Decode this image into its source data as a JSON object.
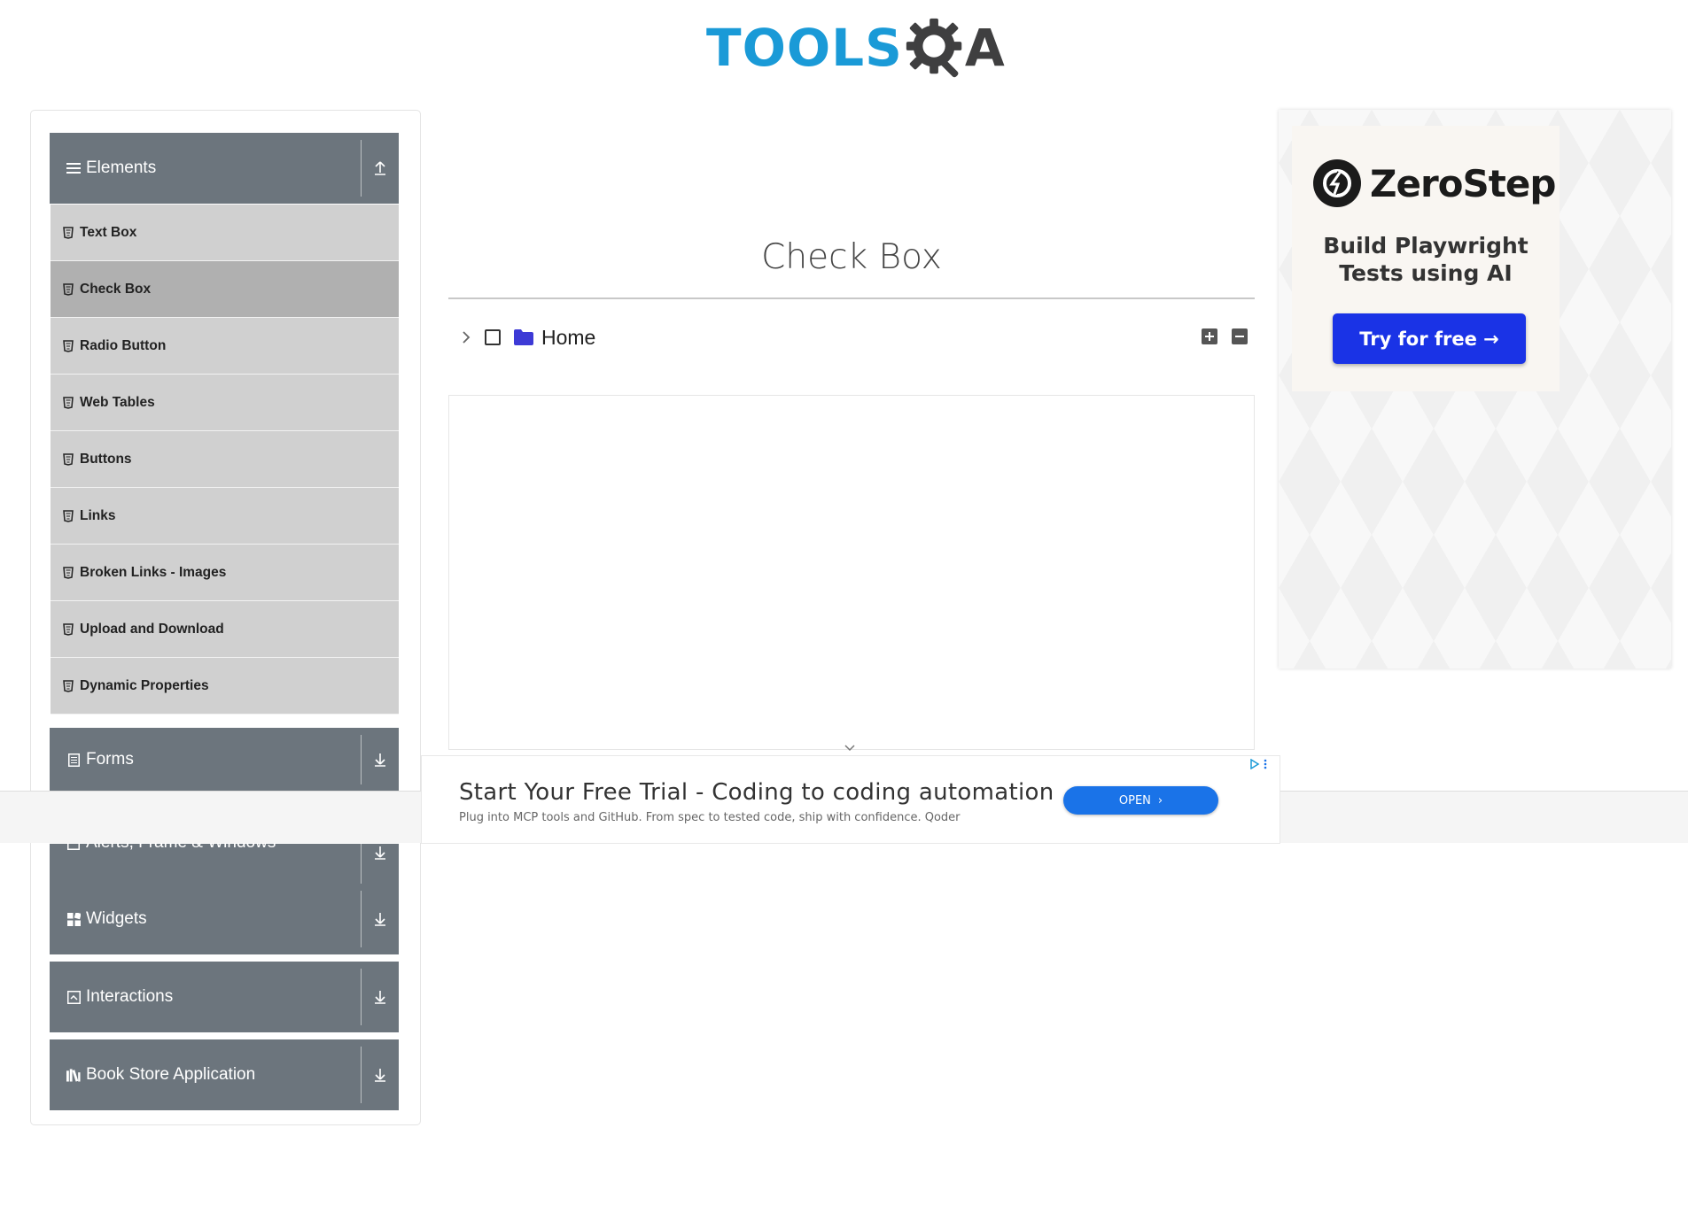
{
  "header": {
    "logo_text_left": "TOOLS",
    "logo_text_right": "A"
  },
  "sidebar": {
    "groups": [
      {
        "label": "Elements",
        "icon": "hamburger-icon",
        "state": "expanded"
      },
      {
        "label": "Forms",
        "icon": "form-icon",
        "state": "collapsed"
      },
      {
        "label": "Alerts, Frame & Windows",
        "icon": "window-icon",
        "state": "collapsed"
      },
      {
        "label": "Widgets",
        "icon": "widgets-icon",
        "state": "collapsed"
      },
      {
        "label": "Interactions",
        "icon": "interactions-icon",
        "state": "collapsed"
      },
      {
        "label": "Book Store Application",
        "icon": "book-icon",
        "state": "collapsed"
      }
    ],
    "items": [
      {
        "label": "Text Box"
      },
      {
        "label": "Check Box",
        "active": true
      },
      {
        "label": "Radio Button"
      },
      {
        "label": "Web Tables"
      },
      {
        "label": "Buttons"
      },
      {
        "label": "Links"
      },
      {
        "label": "Broken Links - Images"
      },
      {
        "label": "Upload and Download"
      },
      {
        "label": "Dynamic Properties"
      }
    ]
  },
  "main": {
    "title": "Check Box",
    "tree": {
      "root_label": "Home",
      "checked": false,
      "expanded": false
    }
  },
  "banner": {
    "title": "Start Your Free Trial - Coding to coding automation",
    "subtitle": "Plug into MCP tools and GitHub. From spec to tested code, ship with confidence. Qoder",
    "button_label": "OPEN"
  },
  "side_ad": {
    "brand": "ZeroStep",
    "headline_line1": "Build Playwright",
    "headline_line2": "Tests using AI",
    "cta": "Try for free →"
  },
  "colors": {
    "sidebar_header": "#6c757d",
    "sidebar_item": "#d0d0d0",
    "sidebar_item_active": "#b0b0b0",
    "logo_blue": "#1a9ad7",
    "folder": "#3d3ad6",
    "open_button": "#1a73e8",
    "ad_cta": "#1a33e6"
  }
}
